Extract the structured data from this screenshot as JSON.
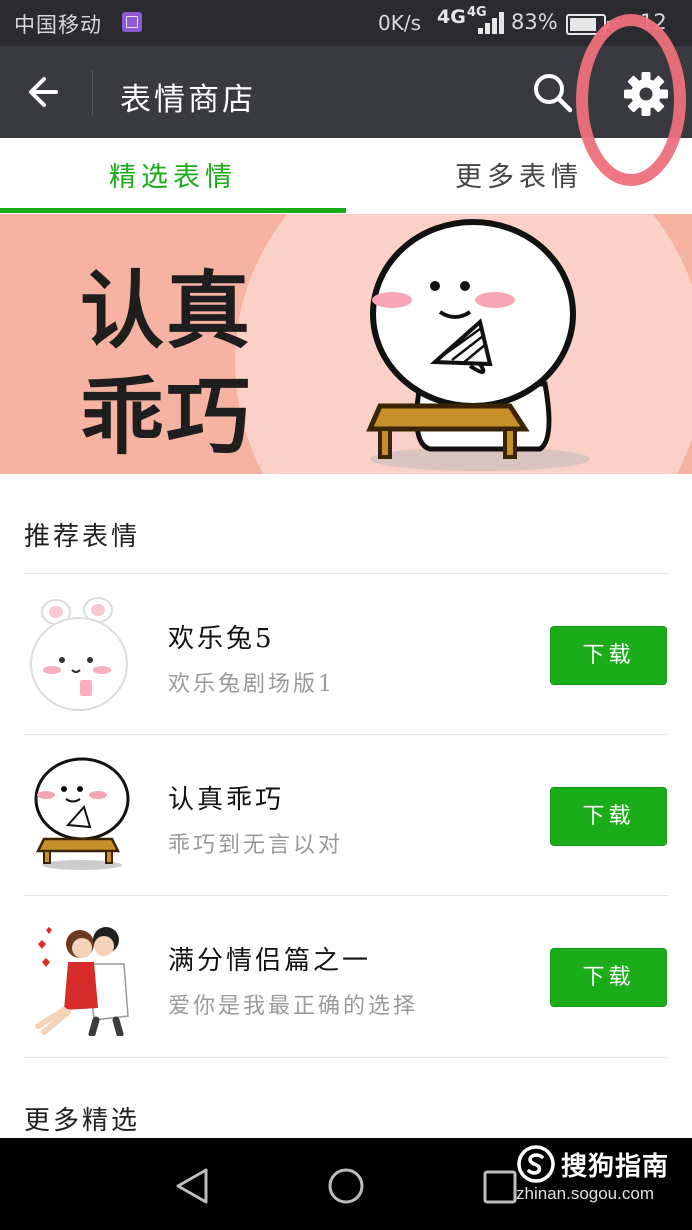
{
  "status_bar": {
    "carrier": "中国移动",
    "speed": "0K/s",
    "network_main": "4G",
    "network_secondary": "4G",
    "battery": "83%",
    "clock": "12",
    "icons": [
      "gallery-icon",
      "signal-icon",
      "battery-icon"
    ]
  },
  "header": {
    "title": "表情商店",
    "icons": [
      "back-arrow-icon",
      "search-icon",
      "gear-icon"
    ]
  },
  "tabs": [
    {
      "label": "精选表情",
      "active": true
    },
    {
      "label": "更多表情",
      "active": false
    }
  ],
  "banner": {
    "line1": "认真",
    "line2": "乖巧"
  },
  "sections": {
    "recommended_title": "推荐表情",
    "more_title": "更多精选"
  },
  "stickers": [
    {
      "name": "欢乐兔5",
      "description": "欢乐兔剧场版1",
      "button": "下载",
      "icon": "bunny-sticker-icon"
    },
    {
      "name": "认真乖巧",
      "description": "乖巧到无言以对",
      "button": "下载",
      "icon": "round-face-sticker-icon"
    },
    {
      "name": "满分情侣篇之一",
      "description": "爱你是我最正确的选择",
      "button": "下载",
      "icon": "couple-sticker-icon"
    }
  ],
  "watermark": {
    "brand": "搜狗指南",
    "url": "zhinan.sogou.com"
  },
  "colors": {
    "accent": "#1aad19",
    "title_bar": "#393a3f",
    "status_bar": "#2b2b2f",
    "annotation": "#ee6f7c",
    "banner_bg": "#f6b3a1"
  }
}
